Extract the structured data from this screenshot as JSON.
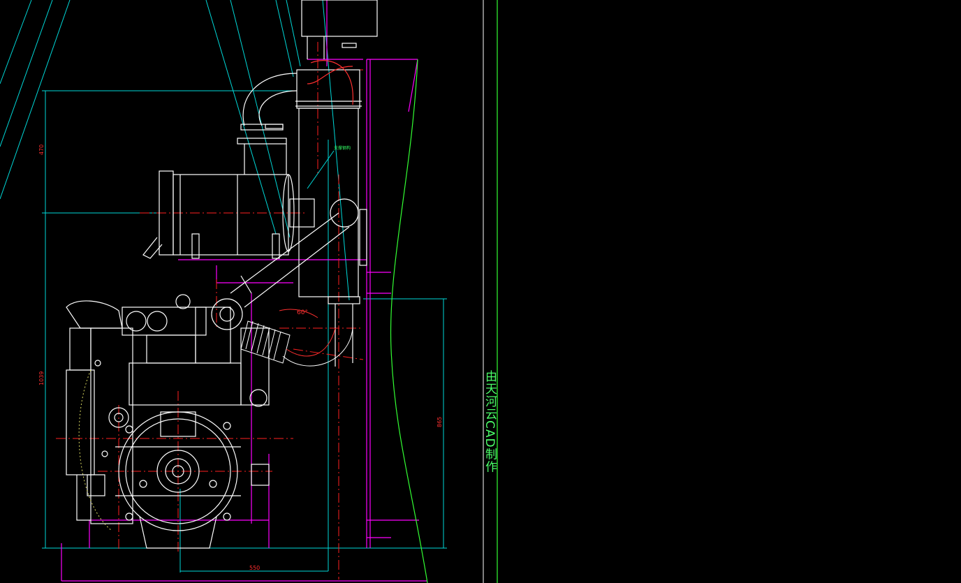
{
  "drawing": {
    "watermark": "由天河云CAD制作",
    "angle_label": "60°",
    "dim_width": "550",
    "dim_height_left_upper": "470",
    "dim_height_left_lower": "1039",
    "dim_height_right": "865",
    "note_label": "支撑钢构",
    "colors": {
      "background": "#000000",
      "geometry": "#ffffff",
      "dimension": "#00e5e5",
      "centerline": "#ff2020",
      "frame": "#ff00ff",
      "outline": "#33ff33",
      "text": "#4cff6a"
    }
  }
}
